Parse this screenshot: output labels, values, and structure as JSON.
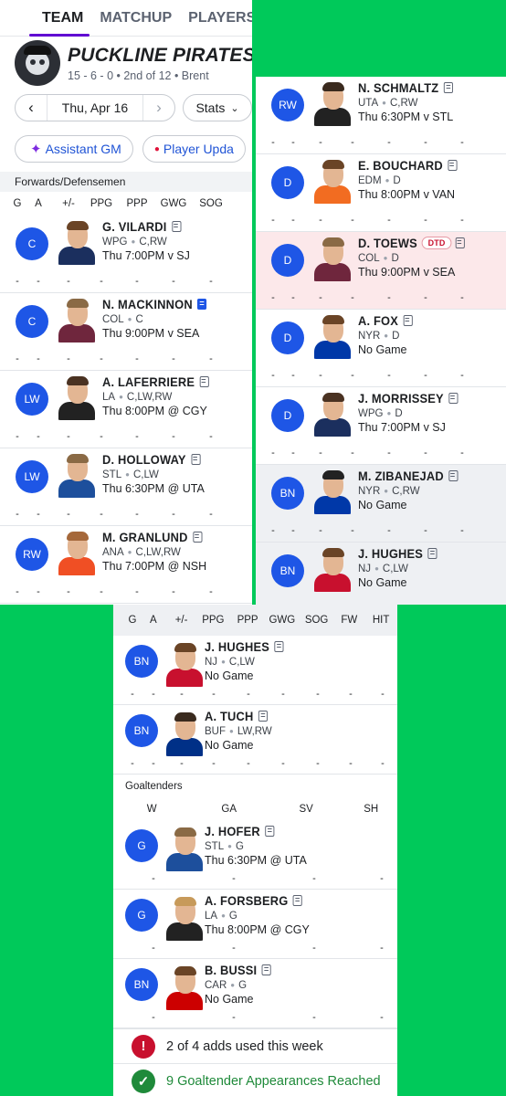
{
  "tabs": [
    "TEAM",
    "MATCHUP",
    "PLAYERS"
  ],
  "team": {
    "name": "PUCKLINE PIRATES",
    "record": "15 - 6 - 0 • 2nd of 12 • Brent"
  },
  "date": {
    "prev": "‹",
    "label": "Thu, Apr 16",
    "next": "›"
  },
  "stats_label": "Stats",
  "chips": {
    "assistant": "Assistant GM",
    "updates": "Player Upda"
  },
  "section_skaters": "Forwards/Defensemen",
  "cols1": [
    "G",
    "A",
    "+/-",
    "PPG",
    "PPP",
    "GWG",
    "SOG"
  ],
  "cols3": [
    "G",
    "A",
    "+/-",
    "PPG",
    "PPP",
    "GWG",
    "SOG",
    "FW",
    "HIT"
  ],
  "goalie_cols": [
    "W",
    "GA",
    "SV",
    "SH"
  ],
  "section_goalies": "Goaltenders",
  "panel1": [
    {
      "pos": "C",
      "name": "G. VILARDI",
      "team": "WPG",
      "elig": "C,RW",
      "game": "Thu 7:00PM v SJ",
      "hair": "#6a4426",
      "shirt": "#1b2f5e"
    },
    {
      "pos": "C",
      "name": "N. MACKINNON",
      "team": "COL",
      "elig": "C",
      "game": "Thu 9:00PM v SEA",
      "hair": "#8a6a45",
      "shirt": "#6f263d",
      "note": "blue"
    },
    {
      "pos": "LW",
      "name": "A. LAFERRIERE",
      "team": "LA",
      "elig": "C,LW,RW",
      "game": "Thu 8:00PM @ CGY",
      "hair": "#4a3222",
      "shirt": "#222"
    },
    {
      "pos": "LW",
      "name": "D. HOLLOWAY",
      "team": "STL",
      "elig": "C,LW",
      "game": "Thu 6:30PM @ UTA",
      "hair": "#8a6a45",
      "shirt": "#1d4f9c"
    },
    {
      "pos": "RW",
      "name": "M. GRANLUND",
      "team": "ANA",
      "elig": "C,LW,RW",
      "game": "Thu 7:00PM @ NSH",
      "hair": "#a5683a",
      "shirt": "#f04f24"
    }
  ],
  "panel2": [
    {
      "pos": "RW",
      "name": "N. SCHMALTZ",
      "team": "UTA",
      "elig": "C,RW",
      "game": "Thu 6:30PM v STL",
      "hair": "#3a2a1e",
      "shirt": "#222"
    },
    {
      "pos": "D",
      "name": "E. BOUCHARD",
      "team": "EDM",
      "elig": "D",
      "game": "Thu 8:00PM v VAN",
      "hair": "#6a4426",
      "shirt": "#f26c21"
    },
    {
      "pos": "D",
      "name": "D. TOEWS",
      "team": "COL",
      "elig": "D",
      "game": "Thu 9:00PM v SEA",
      "hair": "#8a6a45",
      "shirt": "#6f263d",
      "status": "DTD",
      "rowstyle": "dtd"
    },
    {
      "pos": "D",
      "name": "A. FOX",
      "team": "NYR",
      "elig": "D",
      "game": "No Game",
      "hair": "#6a4426",
      "shirt": "#0038a8"
    },
    {
      "pos": "D",
      "name": "J. MORRISSEY",
      "team": "WPG",
      "elig": "D",
      "game": "Thu 7:00PM v SJ",
      "hair": "#4a3222",
      "shirt": "#1b2f5e"
    },
    {
      "pos": "BN",
      "name": "M. ZIBANEJAD",
      "team": "NYR",
      "elig": "C,RW",
      "game": "No Game",
      "hair": "#222",
      "shirt": "#0038a8",
      "rowstyle": "alt"
    },
    {
      "pos": "BN",
      "name": "J. HUGHES",
      "team": "NJ",
      "elig": "C,LW",
      "game": "No Game",
      "hair": "#6a4426",
      "shirt": "#c8102e",
      "rowstyle": "alt"
    }
  ],
  "panel3_skaters": [
    {
      "pos": "BN",
      "name": "J. HUGHES",
      "team": "NJ",
      "elig": "C,LW",
      "game": "No Game",
      "hair": "#6a4426",
      "shirt": "#c8102e"
    },
    {
      "pos": "BN",
      "name": "A. TUCH",
      "team": "BUF",
      "elig": "LW,RW",
      "game": "No Game",
      "hair": "#3a2a1e",
      "shirt": "#003087"
    }
  ],
  "panel3_goalies": [
    {
      "pos": "G",
      "name": "J. HOFER",
      "team": "STL",
      "elig": "G",
      "game": "Thu 6:30PM @ UTA",
      "hair": "#8a6a45",
      "shirt": "#1d4f9c"
    },
    {
      "pos": "G",
      "name": "A. FORSBERG",
      "team": "LA",
      "elig": "G",
      "game": "Thu 8:00PM @ CGY",
      "hair": "#c79a5a",
      "shirt": "#222"
    },
    {
      "pos": "BN",
      "name": "B. BUSSI",
      "team": "CAR",
      "elig": "G",
      "game": "No Game",
      "hair": "#6a4426",
      "shirt": "#cc0000"
    }
  ],
  "alerts": {
    "adds": "2 of 4 adds used this week",
    "goalie": "9 Goaltender Appearances Reached",
    "warn_icon": "!",
    "ok_icon": "✓"
  },
  "dash": "-"
}
